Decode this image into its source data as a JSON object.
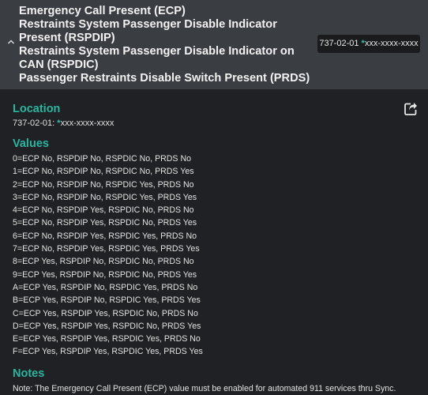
{
  "header": {
    "titles": [
      "Emergency Call Present (ECP)",
      "Restraints System Passenger Disable Indicator Present (RSPDIP)",
      "Restraints System Passenger Disable Indicator on CAN (RSPDIC)",
      "Passenger Restraints Disable Switch Present (PRDS)"
    ],
    "id_prefix": "737-02-01",
    "id_marker": "*",
    "id_value": "xxx-xxxx-xxxx"
  },
  "location": {
    "title": "Location",
    "prefix": "737-02-01:",
    "marker": "*",
    "value": "xxx-xxxx-xxxx"
  },
  "values": {
    "title": "Values",
    "items": [
      "0=ECP No, RSPDIP No, RSPDIC No, PRDS No",
      "1=ECP No, RSPDIP No, RSPDIC No, PRDS Yes",
      "2=ECP No, RSPDIP No, RSPDIC Yes, PRDS No",
      "3=ECP No, RSPDIP No, RSPDIC Yes, PRDS Yes",
      "4=ECP No, RSPDIP Yes, RSPDIC No, PRDS No",
      "5=ECP No, RSPDIP Yes, RSPDIC No, PRDS Yes",
      "6=ECP No, RSPDIP Yes, RSPDIC Yes, PRDS No",
      "7=ECP No, RSPDIP Yes, RSPDIC Yes, PRDS Yes",
      "8=ECP Yes, RSPDIP No, RSPDIC No, PRDS No",
      "9=ECP Yes, RSPDIP No, RSPDIC No, PRDS Yes",
      "A=ECP Yes, RSPDIP No, RSPDIC Yes, PRDS No",
      "B=ECP Yes, RSPDIP No, RSPDIC Yes, PRDS Yes",
      "C=ECP Yes, RSPDIP Yes, RSPDIC No, PRDS No",
      "D=ECP Yes, RSPDIP Yes, RSPDIC No, PRDS Yes",
      "E=ECP Yes, RSPDIP Yes, RSPDIC Yes, PRDS No",
      "F=ECP Yes, RSPDIP Yes, RSPDIC Yes, PRDS Yes"
    ]
  },
  "notes": {
    "title": "Notes",
    "text": "Note: The Emergency Call Present (ECP) value must be enabled for automated 911 services thru Sync."
  },
  "colors": {
    "accent": "#2bb5a0",
    "header_bg": "#3a3d41",
    "page_bg": "#1f2124",
    "id_box_bg": "#1a1b1d"
  },
  "icons": {
    "collapse": "chevron-up-icon",
    "share": "share-icon"
  }
}
